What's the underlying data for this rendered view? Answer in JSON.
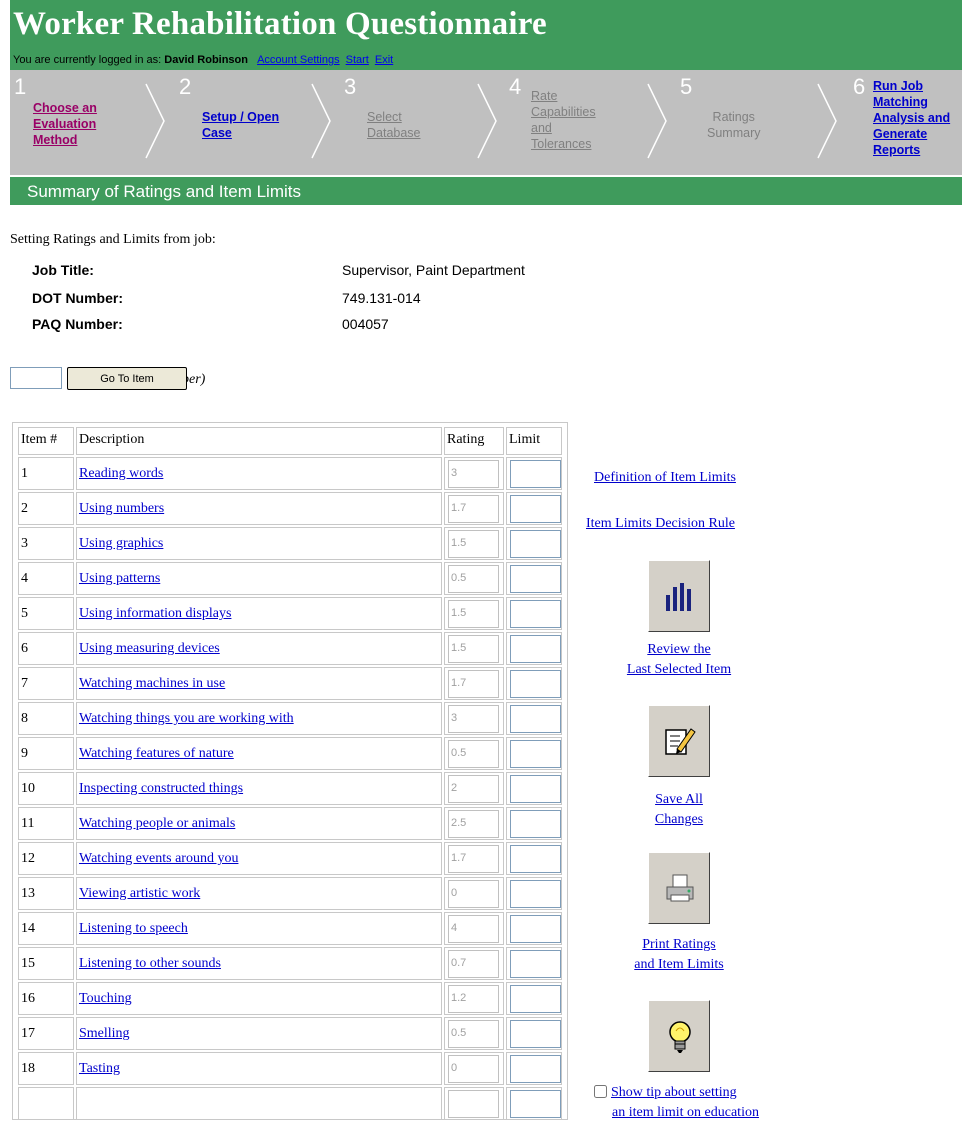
{
  "app": {
    "title": "Worker Rehabilitation Questionnaire",
    "login_prefix": "You are currently logged in as:",
    "user_name": "David Robinson",
    "nav_links": [
      "Account Settings",
      "Start",
      "Exit"
    ]
  },
  "steps": [
    {
      "num": "1",
      "label": "Choose an Evaluation Method",
      "lines": [
        "Choose an",
        "Evaluation",
        "Method"
      ],
      "state": "active"
    },
    {
      "num": "2",
      "label": "Setup / Open Case",
      "lines": [
        "Setup / Open",
        "Case"
      ],
      "state": "done"
    },
    {
      "num": "3",
      "label": "Select Database",
      "lines": [
        "Select",
        "Database"
      ],
      "state": "disabled"
    },
    {
      "num": "4",
      "label": "Rate Capabilities and Tolerances",
      "lines": [
        "Rate",
        "Capabilities",
        "and",
        "Tolerances"
      ],
      "state": "disabled"
    },
    {
      "num": "5",
      "label": "Ratings Summary",
      "lines": [
        "Ratings",
        "Summary"
      ],
      "state": "current"
    },
    {
      "num": "6",
      "label": "Run Job Matching Analysis and Generate Reports",
      "lines": [
        "Run Job",
        "Matching",
        "Analysis and",
        "Generate",
        "Reports"
      ],
      "state": "done"
    }
  ],
  "summary": {
    "title": "Summary of Ratings and Item Limits",
    "caption": "Setting Ratings and Limits from job:",
    "job_title_label": "Job Title:",
    "job_title": "Supervisor, Paint Department",
    "dot_label": "DOT Number:",
    "dot_number": "749.131-014",
    "paq_label": "PAQ Number:",
    "paq_number": "004057"
  },
  "goto": {
    "input_value": "",
    "button_label": "Go To Item",
    "hint_visible": "ber)"
  },
  "table": {
    "headers": [
      "Item #",
      "Description",
      "Rating",
      "Limit"
    ],
    "rows": [
      {
        "num": "1",
        "desc": "Reading words",
        "rating": "3",
        "limit": ""
      },
      {
        "num": "2",
        "desc": "Using numbers",
        "rating": "1.7",
        "limit": ""
      },
      {
        "num": "3",
        "desc": "Using graphics",
        "rating": "1.5",
        "limit": ""
      },
      {
        "num": "4",
        "desc": "Using patterns",
        "rating": "0.5",
        "limit": ""
      },
      {
        "num": "5",
        "desc": "Using information displays",
        "rating": "1.5",
        "limit": ""
      },
      {
        "num": "6",
        "desc": "Using measuring devices",
        "rating": "1.5",
        "limit": ""
      },
      {
        "num": "7",
        "desc": "Watching machines in use",
        "rating": "1.7",
        "limit": ""
      },
      {
        "num": "8",
        "desc": "Watching things you are working with",
        "rating": "3",
        "limit": ""
      },
      {
        "num": "9",
        "desc": "Watching features of nature",
        "rating": "0.5",
        "limit": ""
      },
      {
        "num": "10",
        "desc": "Inspecting constructed things",
        "rating": "2",
        "limit": ""
      },
      {
        "num": "11",
        "desc": "Watching people or animals",
        "rating": "2.5",
        "limit": ""
      },
      {
        "num": "12",
        "desc": "Watching events around you",
        "rating": "1.7",
        "limit": ""
      },
      {
        "num": "13",
        "desc": "Viewing artistic work",
        "rating": "0",
        "limit": ""
      },
      {
        "num": "14",
        "desc": "Listening to speech",
        "rating": "4",
        "limit": ""
      },
      {
        "num": "15",
        "desc": "Listening to other sounds",
        "rating": "0.7",
        "limit": ""
      },
      {
        "num": "16",
        "desc": "Touching",
        "rating": "1.2",
        "limit": ""
      },
      {
        "num": "17",
        "desc": "Smelling",
        "rating": "0.5",
        "limit": ""
      },
      {
        "num": "18",
        "desc": "Tasting",
        "rating": "0",
        "limit": ""
      }
    ]
  },
  "side": {
    "definition_link": "Definition of Item Limits",
    "decision_rule_link": "Item Limits Decision Rule",
    "review_caption": [
      "Review the",
      "Last Selected Item"
    ],
    "save_caption": [
      "Save All",
      "Changes"
    ],
    "print_caption": [
      "Print Ratings",
      "and Item Limits"
    ],
    "tip_label_visible": "Show tip about setting",
    "tip_label_cut": "an item limit on education",
    "icons": {
      "review": "bar-chart-icon",
      "save": "edit-document-icon",
      "print": "printer-icon",
      "tip": "lightbulb-icon"
    }
  },
  "colors": {
    "header_green": "#3f9b5c",
    "step_gray": "#c0c0c0",
    "link_blue": "#0000cc",
    "active_step": "#990066"
  }
}
